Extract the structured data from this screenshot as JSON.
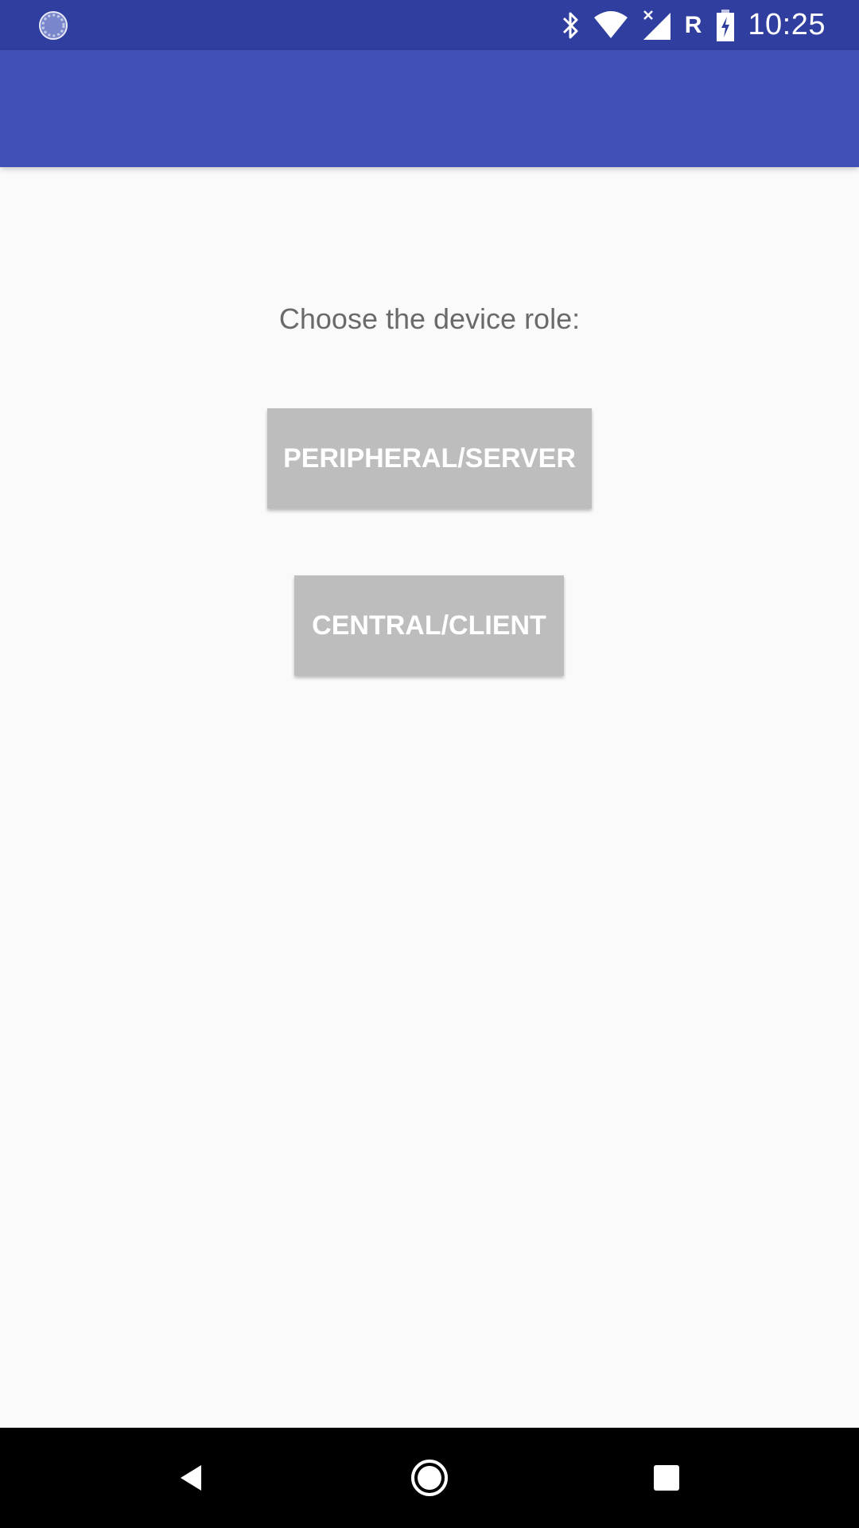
{
  "status_bar": {
    "time": "10:25",
    "roaming_indicator": "R",
    "icons": [
      "sync-icon",
      "bluetooth-icon",
      "wifi-icon",
      "cellular-no-data-icon",
      "battery-charging-icon"
    ]
  },
  "app_bar": {
    "title": ""
  },
  "main": {
    "prompt": "Choose the device role:",
    "buttons": [
      {
        "label": "PERIPHERAL/SERVER"
      },
      {
        "label": "CENTRAL/CLIENT"
      }
    ]
  },
  "nav_bar": {
    "icons": [
      "back-icon",
      "home-icon",
      "recents-icon"
    ]
  },
  "colors": {
    "status_bar": "#303f9f",
    "app_bar": "#3f51b5",
    "background": "#fafafa",
    "button": "#bdbdbd",
    "button_text": "#ffffff",
    "prompt_text": "#6a6a6a",
    "nav_bar": "#000000"
  }
}
